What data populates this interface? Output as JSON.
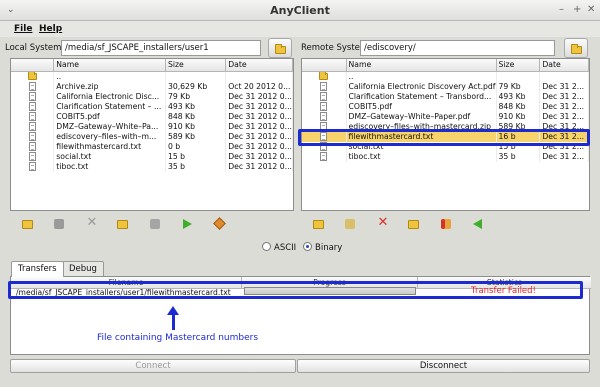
{
  "window": {
    "title": "AnyClient",
    "controls": [
      "–",
      "+",
      "✕"
    ],
    "menu_glyph": "⌄"
  },
  "menu": {
    "file": "File",
    "help": "Help"
  },
  "local": {
    "label": "Local System",
    "path": "/media/sf_JSCAPE_installers/user1",
    "columns": {
      "name": "Name",
      "size": "Size",
      "date": "Date"
    },
    "files": [
      {
        "type": "folder",
        "name": "..",
        "size": "",
        "date": ""
      },
      {
        "type": "file",
        "name": "Archive.zip",
        "size": "30,629 Kb",
        "date": "Oct 20 2012 0..."
      },
      {
        "type": "file",
        "name": "California Electronic Disc...",
        "size": "79 Kb",
        "date": "Dec 31 2012 0..."
      },
      {
        "type": "file",
        "name": "Clarification Statement – ...",
        "size": "493 Kb",
        "date": "Dec 31 2012 0..."
      },
      {
        "type": "file",
        "name": "COBIT5.pdf",
        "size": "848 Kb",
        "date": "Dec 31 2012 0..."
      },
      {
        "type": "file",
        "name": "DMZ–Gateway–White–Pa...",
        "size": "910 Kb",
        "date": "Dec 31 2012 0..."
      },
      {
        "type": "file",
        "name": "ediscovery–files–with–m...",
        "size": "589 Kb",
        "date": "Dec 31 2012 0..."
      },
      {
        "type": "file",
        "name": "filewithmastercard.txt",
        "size": "0 b",
        "date": "Dec 31 2012 0..."
      },
      {
        "type": "file",
        "name": "social.txt",
        "size": "15 b",
        "date": "Dec 31 2012 0..."
      },
      {
        "type": "file",
        "name": "tiboc.txt",
        "size": "35 b",
        "date": "Dec 31 2012 0..."
      }
    ]
  },
  "remote": {
    "label": "Remote System",
    "path": "/ediscovery/",
    "columns": {
      "name": "Name",
      "size": "Size",
      "date": "Date"
    },
    "files": [
      {
        "type": "folder",
        "name": "..",
        "size": "",
        "date": ""
      },
      {
        "type": "file",
        "name": "California Electronic Discovery Act.pdf",
        "size": "79 Kb",
        "date": "Dec 31 2..."
      },
      {
        "type": "file",
        "name": "Clarification Statement – Transbord...",
        "size": "493 Kb",
        "date": "Dec 31 2..."
      },
      {
        "type": "file",
        "name": "COBIT5.pdf",
        "size": "848 Kb",
        "date": "Dec 31 2..."
      },
      {
        "type": "file",
        "name": "DMZ–Gateway–White–Paper.pdf",
        "size": "910 Kb",
        "date": "Dec 31 2..."
      },
      {
        "type": "file",
        "name": "ediscovery–files–with–mastercard.zip",
        "size": "589 Kb",
        "date": "Dec 31 2..."
      },
      {
        "type": "file",
        "name": "filewithmastercard.txt",
        "size": "16 b",
        "date": "Dec 31 2...",
        "selected": true
      },
      {
        "type": "file",
        "name": "social.txt",
        "size": "15 b",
        "date": "Dec 31 2..."
      },
      {
        "type": "file",
        "name": "tiboc.txt",
        "size": "35 b",
        "date": "Dec 31 2..."
      }
    ]
  },
  "mode": {
    "ascii": "ASCII",
    "binary": "Binary",
    "selected": "binary"
  },
  "tabs": {
    "transfers": "Transfers",
    "debug": "Debug"
  },
  "transfers": {
    "columns": {
      "filename": "Filename",
      "progress": "Progress",
      "statistics": "Statistics"
    },
    "row": {
      "path": "/media/sf_JSCAPE_installers/user1/filewithmastercard.txt",
      "status": "Transfer Failed!",
      "progress": 0
    }
  },
  "annotation": {
    "text": "File containing Mastercard numbers",
    "highlight_color": "#1c2bd0"
  },
  "buttons": {
    "connect": "Connect",
    "disconnect": "Disconnect"
  },
  "colors": {
    "selected_row": "#f7d36b",
    "error": "#e0262b"
  }
}
